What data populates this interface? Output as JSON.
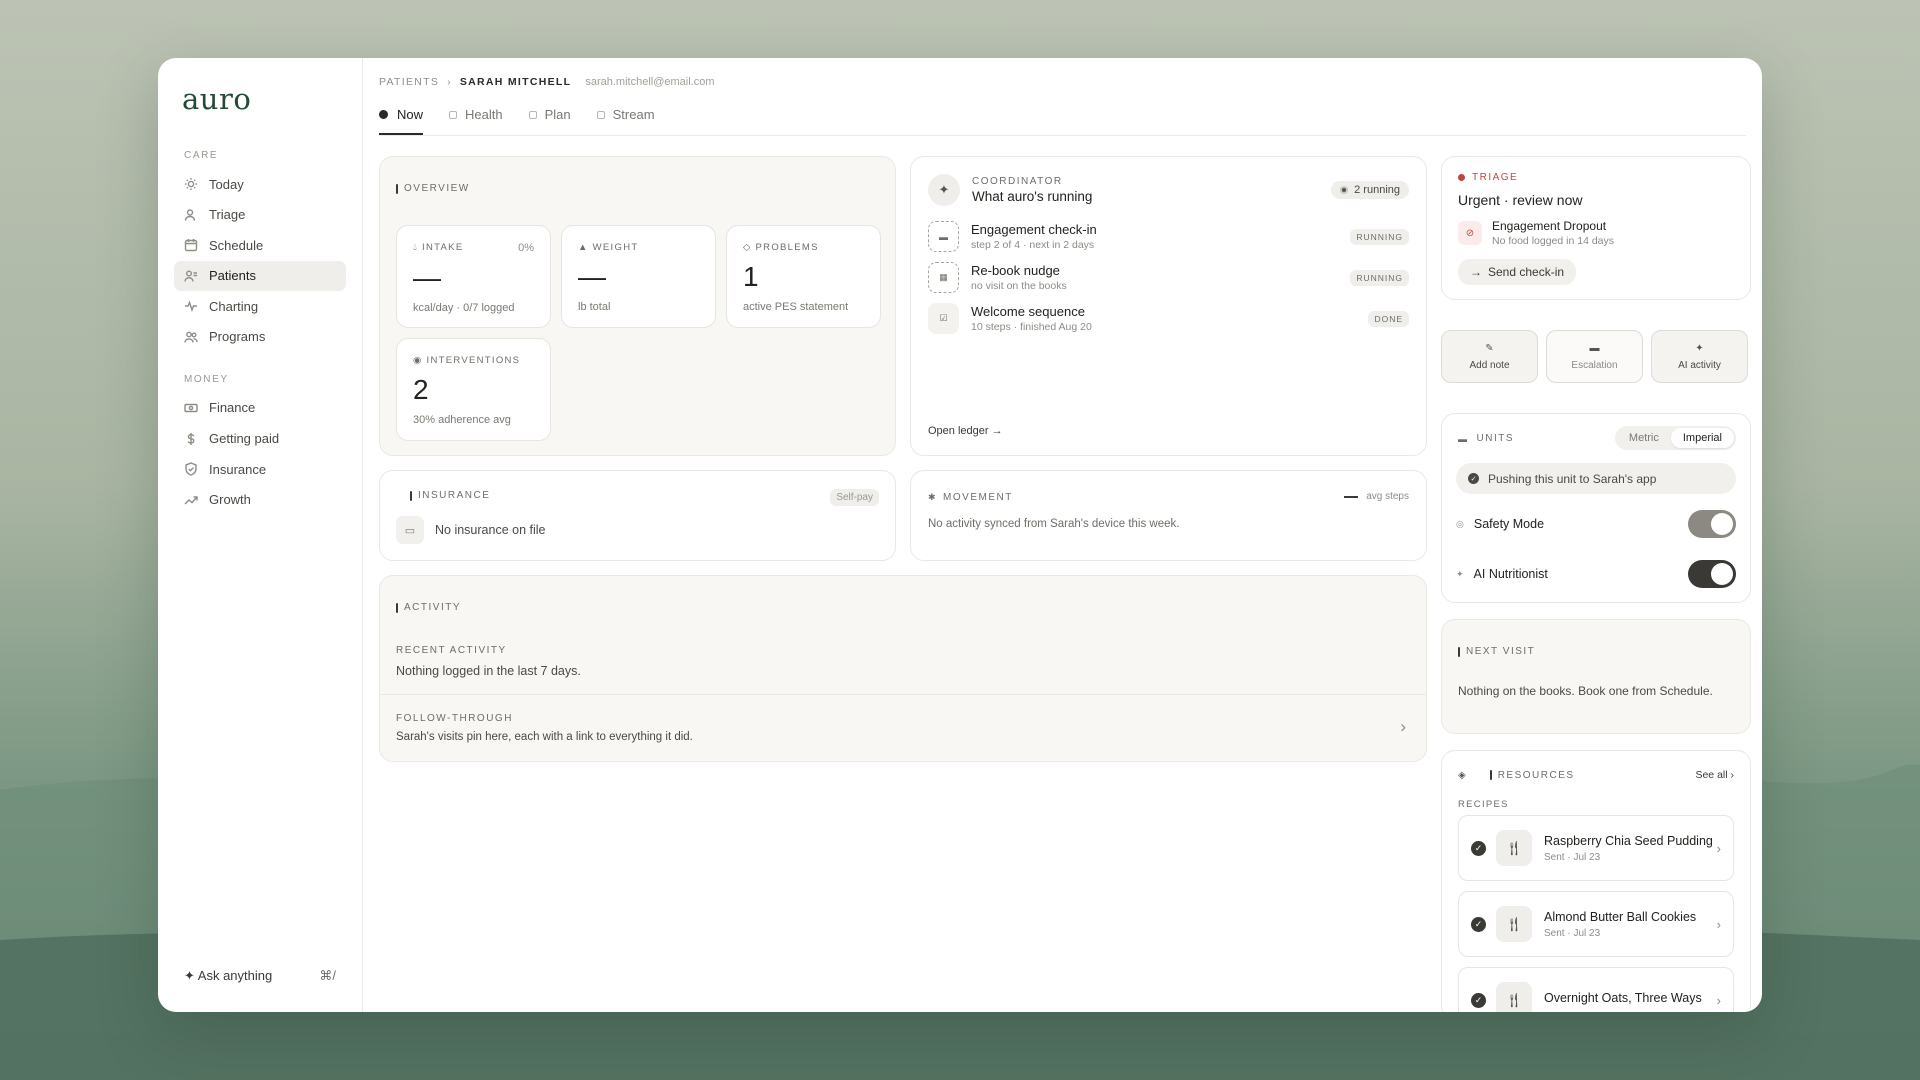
{
  "app": {
    "logo": "auro"
  },
  "sidebar": {
    "care_label": "CARE",
    "care_items": [
      {
        "label": "Today",
        "icon": "sun-icon"
      },
      {
        "label": "Triage",
        "icon": "user-alert-icon"
      },
      {
        "label": "Schedule",
        "icon": "calendar-icon"
      },
      {
        "label": "Patients",
        "icon": "patients-icon",
        "active": true
      },
      {
        "label": "Charting",
        "icon": "pulse-icon"
      },
      {
        "label": "Programs",
        "icon": "people-icon"
      }
    ],
    "money_label": "MONEY",
    "money_items": [
      {
        "label": "Finance",
        "icon": "cash-icon"
      },
      {
        "label": "Getting paid",
        "icon": "dollar-icon"
      },
      {
        "label": "Insurance",
        "icon": "shield-icon"
      },
      {
        "label": "Growth",
        "icon": "trend-icon"
      }
    ],
    "ask": {
      "label": "Ask anything",
      "shortcut": "⌘/"
    }
  },
  "breadcrumb": {
    "root": "PATIENTS",
    "current": "SARAH MITCHELL",
    "email": "sarah.mitchell@email.com"
  },
  "tabs": [
    "Now",
    "Health",
    "Plan",
    "Stream"
  ],
  "overview": {
    "label": "OVERVIEW",
    "intake": {
      "label": "INTAKE",
      "pct": "0%",
      "value": "—",
      "sub": "kcal/day · 0/7 logged"
    },
    "weight": {
      "label": "WEIGHT",
      "value": "—",
      "sub": "lb total"
    },
    "problems": {
      "label": "PROBLEMS",
      "value": "1",
      "sub": "active PES statement"
    },
    "interventions": {
      "label": "INTERVENTIONS",
      "value": "2",
      "sub": "30% adherence avg"
    }
  },
  "coordinator": {
    "kicker": "COORDINATOR",
    "title": "What auro's running",
    "pill": "2 running",
    "jobs": [
      {
        "name": "Engagement check-in",
        "sub": "step 2 of 4 · next in 2 days",
        "badge": "RUNNING"
      },
      {
        "name": "Re-book nudge",
        "sub": "no visit on the books",
        "badge": "RUNNING"
      },
      {
        "name": "Welcome sequence",
        "sub": "10 steps · finished Aug 20",
        "badge": "DONE"
      }
    ],
    "ledger": "Open ledger →"
  },
  "insurance": {
    "label": "INSURANCE",
    "badge": "Self-pay",
    "text": "No insurance on file"
  },
  "movement": {
    "label": "MOVEMENT",
    "legend": "avg steps",
    "text": "No activity synced from Sarah's device this week."
  },
  "activity": {
    "label": "ACTIVITY",
    "recent_label": "RECENT ACTIVITY",
    "recent_text": "Nothing logged in the last 7 days.",
    "follow_label": "FOLLOW-THROUGH",
    "follow_text": "Sarah's visits pin here, each with a link to everything it did."
  },
  "triage": {
    "kicker": "TRIAGE",
    "title": "Urgent · review now",
    "alert_title": "Engagement Dropout",
    "alert_sub": "No food logged in 14 days",
    "button": "Send check-in"
  },
  "actions": [
    "Add note",
    "Escalation",
    "AI activity"
  ],
  "units": {
    "label": "UNITS",
    "options": [
      "Metric",
      "Imperial"
    ],
    "selected": "Imperial",
    "push_text": "Pushing this unit to Sarah's app",
    "safety": "Safety Mode",
    "nutritionist": "AI Nutritionist"
  },
  "next_visit": {
    "label": "NEXT VISIT",
    "text": "Nothing on the books. Book one from Schedule."
  },
  "resources": {
    "label": "RESOURCES",
    "see_all": "See all",
    "section": "RECIPES",
    "items": [
      {
        "name": "Raspberry Chia Seed Pudding",
        "sub": "Sent · Jul 23"
      },
      {
        "name": "Almond Butter Ball Cookies",
        "sub": "Sent · Jul 23"
      },
      {
        "name": "Overnight Oats, Three Ways",
        "sub": ""
      }
    ]
  },
  "colors": {
    "brand": "#234a36",
    "urgent": "#c0463f",
    "toggle_on": "#3a3935"
  }
}
